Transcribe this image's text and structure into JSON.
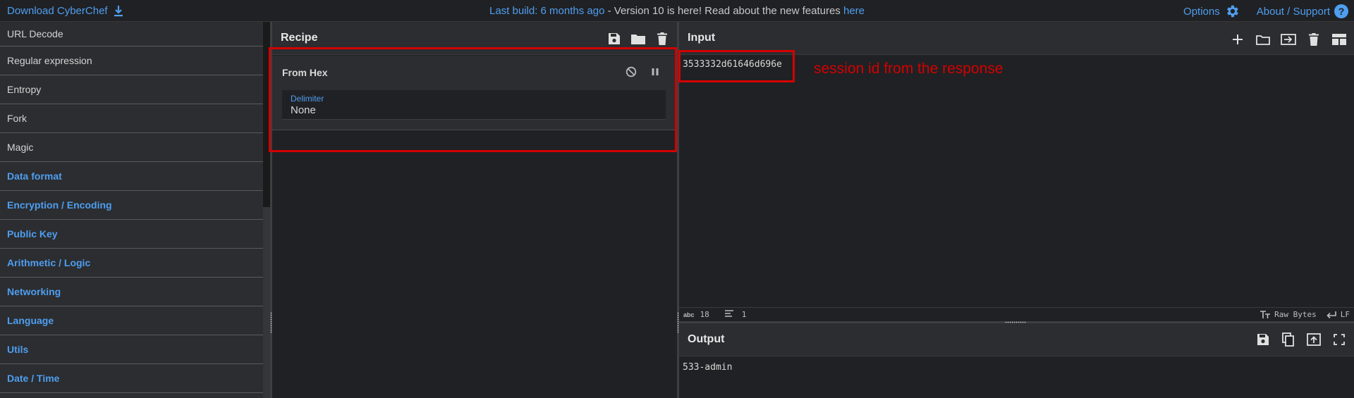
{
  "topbar": {
    "download_label": "Download CyberChef",
    "notice_link": "Last build: 6 months ago",
    "notice_text": " - Version 10 is here! Read about the new features ",
    "notice_here": "here",
    "options_label": "Options",
    "about_label": "About / Support",
    "about_icon": "?"
  },
  "operations": [
    {
      "label": "URL Decode",
      "category": false
    },
    {
      "label": "Regular expression",
      "category": false
    },
    {
      "label": "Entropy",
      "category": false
    },
    {
      "label": "Fork",
      "category": false
    },
    {
      "label": "Magic",
      "category": false
    },
    {
      "label": "Data format",
      "category": true
    },
    {
      "label": "Encryption / Encoding",
      "category": true
    },
    {
      "label": "Public Key",
      "category": true
    },
    {
      "label": "Arithmetic / Logic",
      "category": true
    },
    {
      "label": "Networking",
      "category": true
    },
    {
      "label": "Language",
      "category": true
    },
    {
      "label": "Utils",
      "category": true
    },
    {
      "label": "Date / Time",
      "category": true
    }
  ],
  "recipe": {
    "title": "Recipe",
    "operation": {
      "name": "From Hex",
      "arg_label": "Delimiter",
      "arg_value": "None"
    }
  },
  "input": {
    "title": "Input",
    "value": "3533332d61646d696e",
    "annotation": "session id from the response",
    "status": {
      "chars_icon": "abc",
      "chars": "18",
      "lines": "1",
      "encoding": "Raw Bytes",
      "eol": "LF"
    }
  },
  "output": {
    "title": "Output",
    "value": "533-admin"
  },
  "colors": {
    "accent": "#4f9ef0",
    "annotation": "#d40000",
    "background": "#202124",
    "panel": "#2b2d30"
  }
}
